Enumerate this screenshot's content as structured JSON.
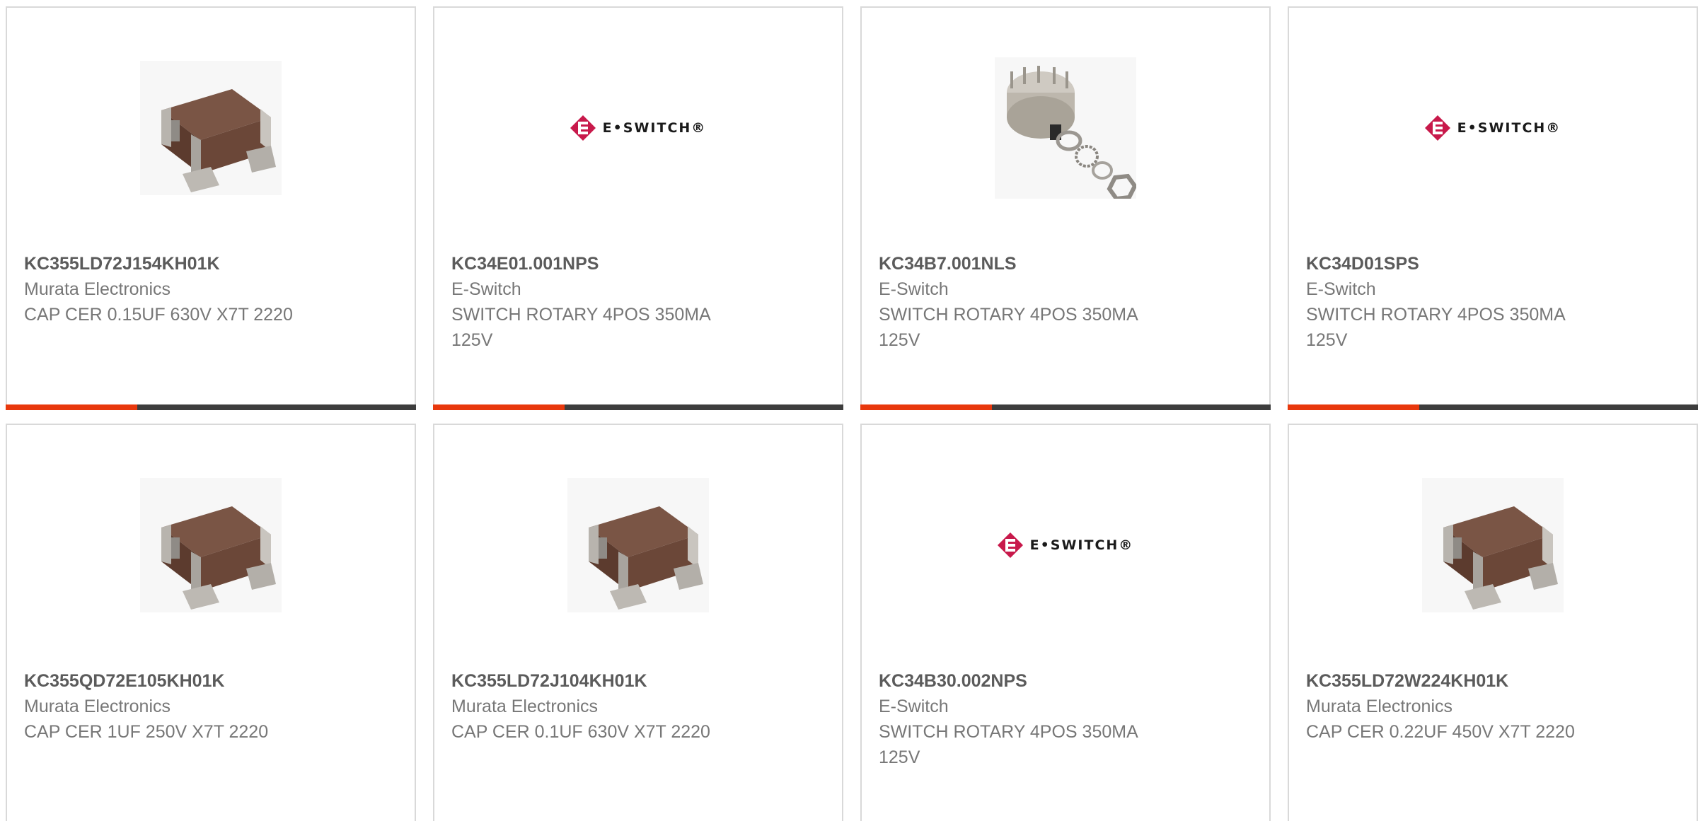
{
  "brand_colors": {
    "accent": "#e8380d",
    "bar_dark": "#3d3d3d",
    "logo_pink": "#c8194b"
  },
  "products": [
    {
      "part_number": "KC355LD72J154KH01K",
      "manufacturer": "Murata Electronics",
      "description": "CAP CER 0.15UF 630V X7T 2220",
      "image": "capacitor-image"
    },
    {
      "part_number": "KC34E01.001NPS",
      "manufacturer": "E-Switch",
      "description": "SWITCH ROTARY 4POS 350MA 125V",
      "image": "eswitch-logo",
      "logo_text": "E•SWITCH®"
    },
    {
      "part_number": "KC34B7.001NLS",
      "manufacturer": "E-Switch",
      "description": "SWITCH ROTARY 4POS 350MA 125V",
      "image": "rotary-switch-image"
    },
    {
      "part_number": "KC34D01SPS",
      "manufacturer": "E-Switch",
      "description": "SWITCH ROTARY 4POS 350MA 125V",
      "image": "eswitch-logo",
      "logo_text": "E•SWITCH®"
    },
    {
      "part_number": "KC355QD72E105KH01K",
      "manufacturer": "Murata Electronics",
      "description": "CAP CER 1UF 250V X7T 2220",
      "image": "capacitor-image"
    },
    {
      "part_number": "KC355LD72J104KH01K",
      "manufacturer": "Murata Electronics",
      "description": "CAP CER 0.1UF 630V X7T 2220",
      "image": "capacitor-image"
    },
    {
      "part_number": "KC34B30.002NPS",
      "manufacturer": "E-Switch",
      "description": "SWITCH ROTARY 4POS 350MA 125V",
      "image": "eswitch-logo",
      "logo_text": "E•SWITCH®"
    },
    {
      "part_number": "KC355LD72W224KH01K",
      "manufacturer": "Murata Electronics",
      "description": "CAP CER 0.22UF 450V X7T 2220",
      "image": "capacitor-image"
    }
  ]
}
